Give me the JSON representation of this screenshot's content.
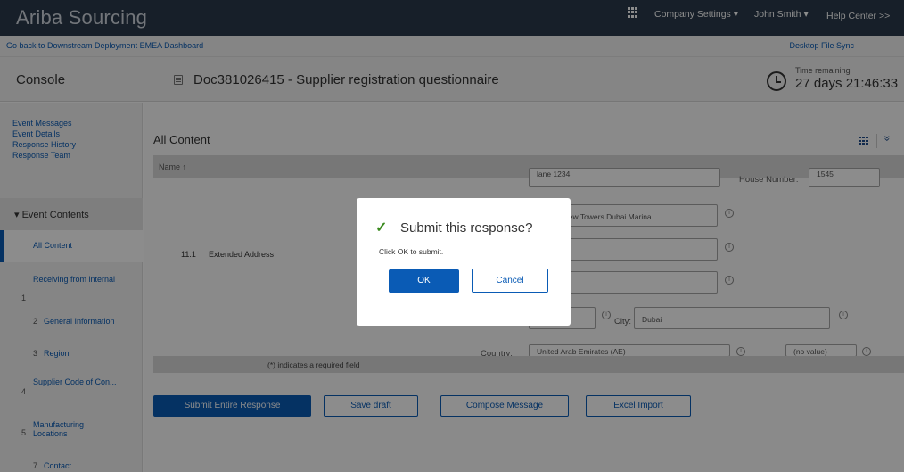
{
  "header": {
    "brand": "Ariba Sourcing",
    "company_settings": "Company Settings ▾",
    "user": "John Smith ▾",
    "help": "Help Center >>"
  },
  "subheader": {
    "back_link": "Go back to Downstream Deployment EMEA Dashboard",
    "desktop_sync": "Desktop File Sync"
  },
  "titlebar": {
    "console": "Console",
    "doc_title": "Doc381026415 - Supplier registration questionnaire",
    "time_remaining_label": "Time remaining",
    "time_remaining_value": "27 days 21:46:33"
  },
  "sidebar": {
    "links": [
      "Event Messages",
      "Event Details",
      "Response History",
      "Response Team"
    ],
    "event_contents": "Event Contents",
    "all_content": "All Content",
    "items": [
      {
        "num": "1",
        "label": "Receiving from internal"
      },
      {
        "num": "2",
        "label": "General Information"
      },
      {
        "num": "3",
        "label": "Region"
      },
      {
        "num": "4",
        "label": "Supplier Code of Con..."
      },
      {
        "num": "5",
        "label": "Manufacturing Locations"
      },
      {
        "num": "7",
        "label": "Contact"
      }
    ]
  },
  "main": {
    "title": "All Content",
    "name_header": "Name ↑",
    "row_num": "11.1",
    "row_label": "Extended Address",
    "field_street": "lane 1234",
    "house_number_label": "House Number:",
    "field_house_number": "1545",
    "field_address_line": "Marina View Towers Dubai Marina",
    "city_label": "City:",
    "field_city": "Dubai",
    "country_label": "Country:",
    "field_country": "United Arab Emirates (AE)",
    "field_no_value": "(no value)",
    "required_note": "(*) indicates a required field"
  },
  "actions": {
    "submit": "Submit Entire Response",
    "save_draft": "Save draft",
    "compose": "Compose Message",
    "excel": "Excel Import"
  },
  "dialog": {
    "title": "Submit this response?",
    "message": "Click OK to submit.",
    "ok": "OK",
    "cancel": "Cancel"
  }
}
